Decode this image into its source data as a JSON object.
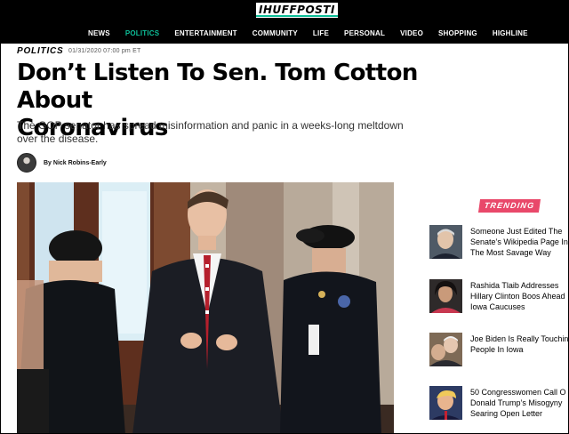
{
  "header": {
    "logo_text": "IHUFFPOSTI",
    "nav": [
      {
        "label": "NEWS",
        "active": false
      },
      {
        "label": "POLITICS",
        "active": true
      },
      {
        "label": "ENTERTAINMENT",
        "active": false
      },
      {
        "label": "COMMUNITY",
        "active": false
      },
      {
        "label": "LIFE",
        "active": false
      },
      {
        "label": "PERSONAL",
        "active": false
      },
      {
        "label": "VIDEO",
        "active": false
      },
      {
        "label": "SHOPPING",
        "active": false
      },
      {
        "label": "HIGHLINE",
        "active": false
      }
    ],
    "active_color": "#0dbe98"
  },
  "article": {
    "section": "POLITICS",
    "dateline": "01/31/2020 07:00 pm ET",
    "headline_line1": "Don’t Listen To Sen. Tom Cotton About",
    "headline_line2": "Coronavirus",
    "subhead_line1": "The GOP senator has spread misinformation and panic in a weeks-long meltdown",
    "subhead_line2": "over the disease.",
    "byline": "By Nick Robins-Early"
  },
  "trending": {
    "badge": "TRENDING",
    "badge_color": "#e9486a",
    "items": [
      {
        "lines": [
          "Someone Just Edited The",
          "Senate’s Wikipedia Page In",
          "The Most Savage Way"
        ]
      },
      {
        "lines": [
          "Rashida Tlaib Addresses",
          "Hillary Clinton Boos Ahead",
          "Iowa Caucuses"
        ]
      },
      {
        "lines": [
          "Joe Biden Is Really Touchin",
          "People In Iowa"
        ]
      },
      {
        "lines": [
          "50 Congresswomen Call O",
          "Donald Trump’s Misogyny",
          "Searing Open Letter"
        ]
      }
    ]
  }
}
